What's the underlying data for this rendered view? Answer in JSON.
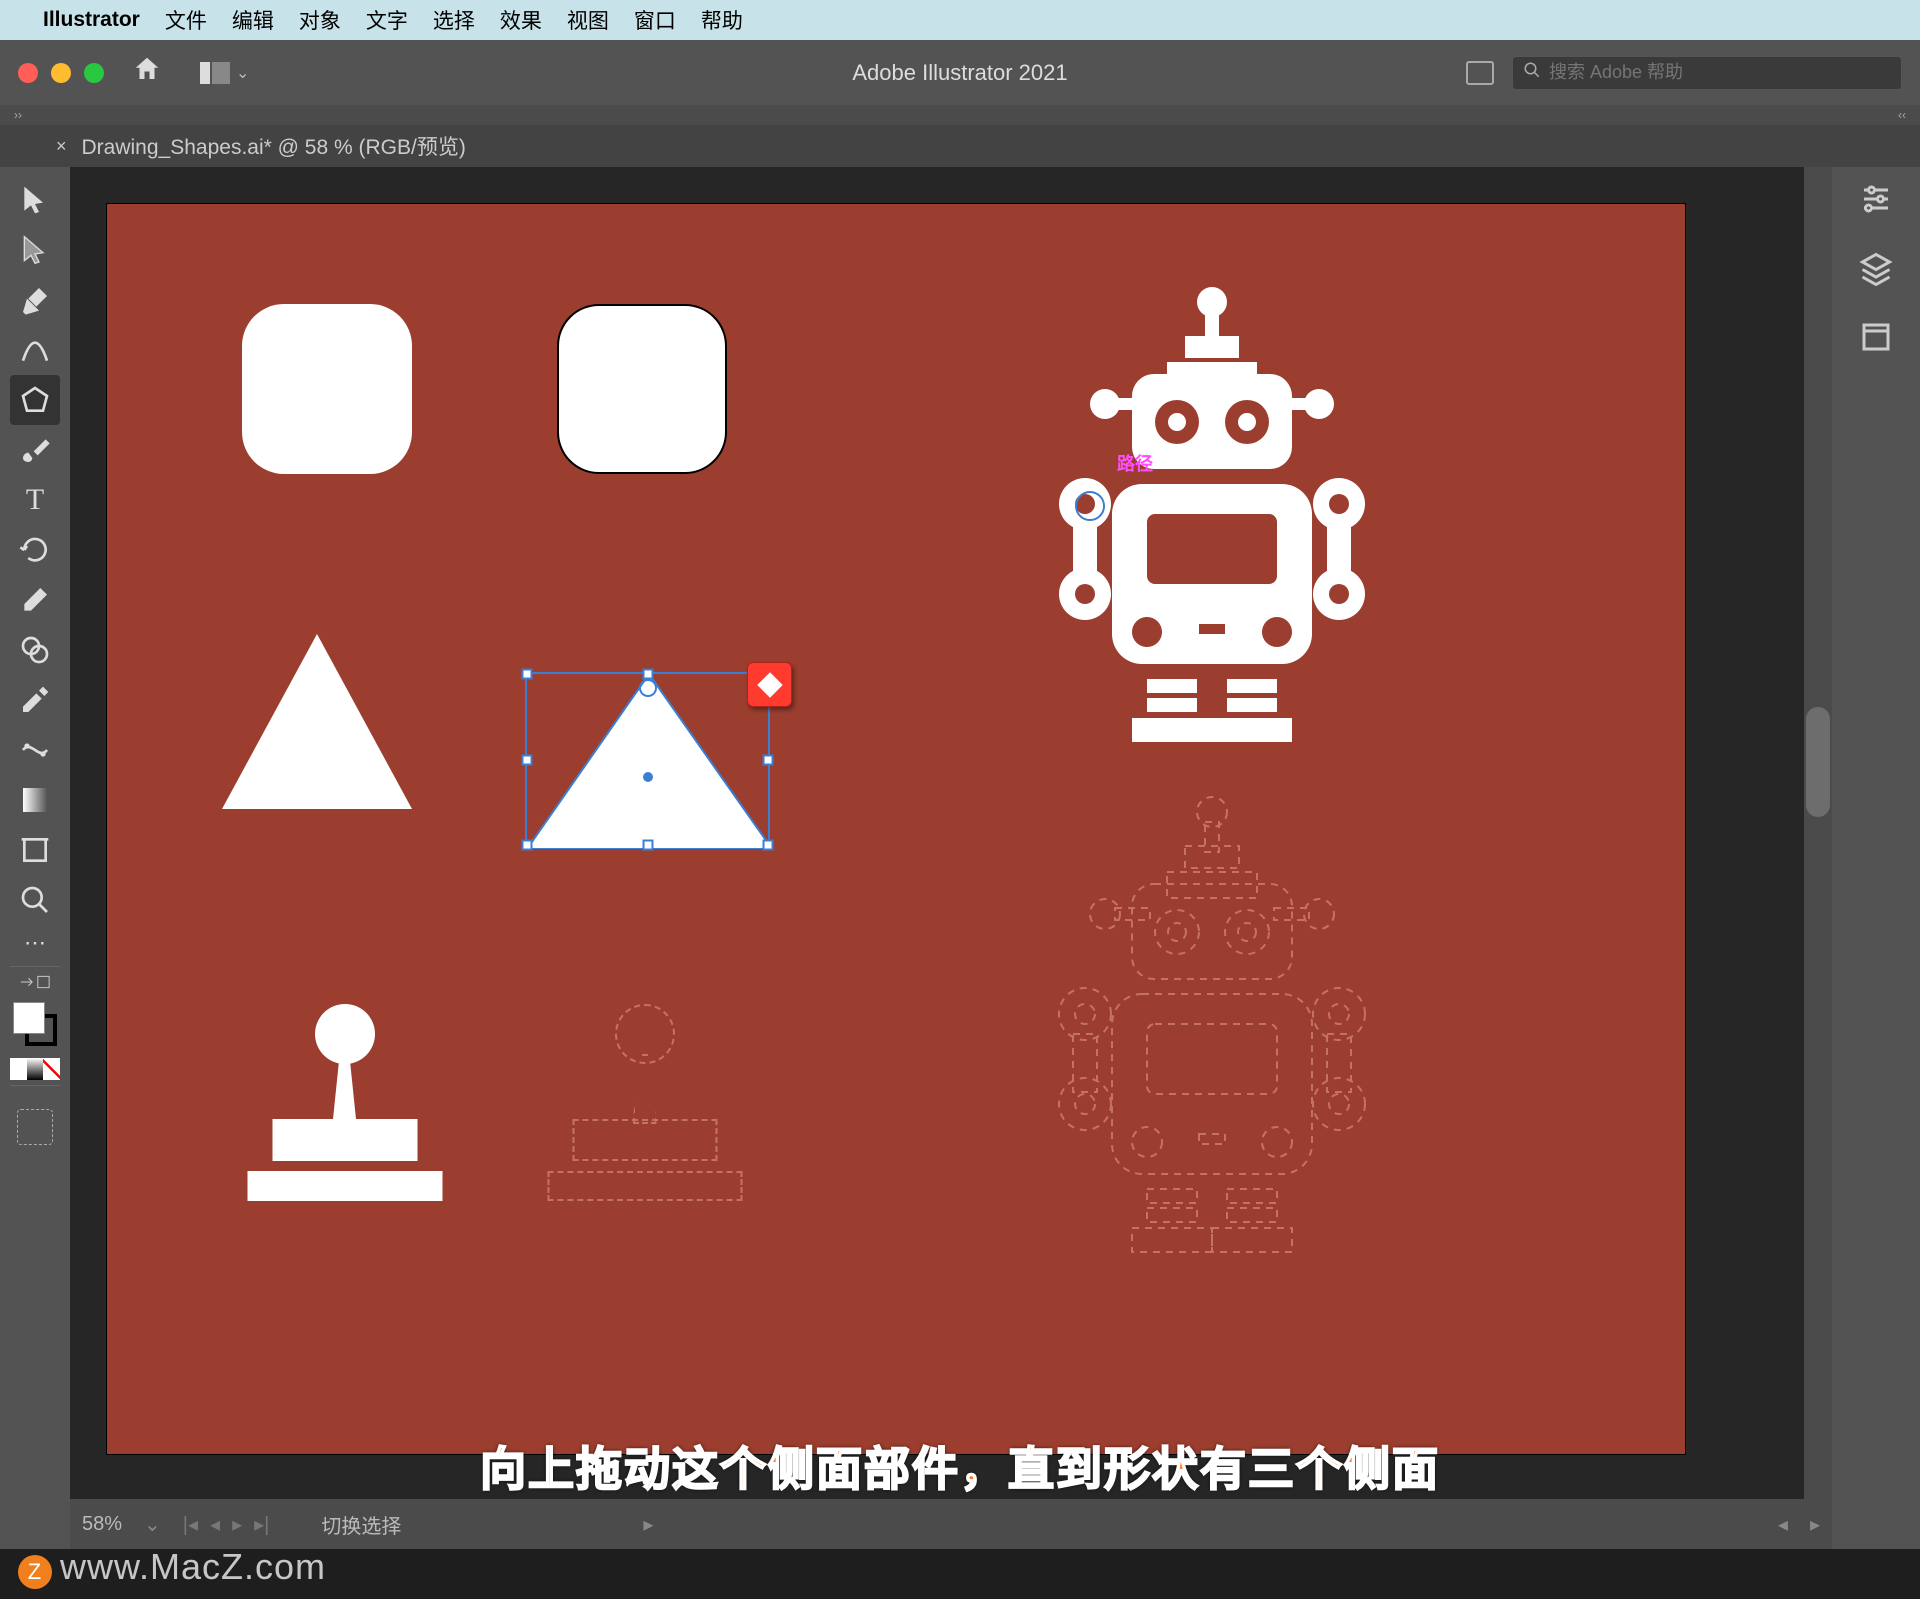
{
  "mac_menu": {
    "app": "Illustrator",
    "items": [
      "文件",
      "编辑",
      "对象",
      "文字",
      "选择",
      "效果",
      "视图",
      "窗口",
      "帮助"
    ]
  },
  "window": {
    "title": "Adobe Illustrator 2021",
    "search_placeholder": "搜索 Adobe 帮助"
  },
  "document": {
    "tab_label": "Drawing_Shapes.ai* @ 58 % (RGB/预览)"
  },
  "canvas": {
    "path_label": "路径"
  },
  "status": {
    "zoom": "58%",
    "selection_label": "切换选择"
  },
  "caption": "向上拖动这个侧面部件，直到形状有三个侧面",
  "watermark": "www.MacZ.com",
  "tools": [
    {
      "name": "selection-tool",
      "glyph": "arrow"
    },
    {
      "name": "direct-selection-tool",
      "glyph": "darrow"
    },
    {
      "name": "pen-tool",
      "glyph": "pen"
    },
    {
      "name": "curvature-tool",
      "glyph": "curve"
    },
    {
      "name": "polygon-tool",
      "glyph": "hex",
      "selected": true
    },
    {
      "name": "paintbrush-tool",
      "glyph": "brush"
    },
    {
      "name": "type-tool",
      "glyph": "T"
    },
    {
      "name": "rotate-tool",
      "glyph": "rotate"
    },
    {
      "name": "eraser-tool",
      "glyph": "eraser"
    },
    {
      "name": "shape-builder-tool",
      "glyph": "shapeb"
    },
    {
      "name": "eyedropper-tool",
      "glyph": "eyedrop"
    },
    {
      "name": "width-tool",
      "glyph": "width"
    },
    {
      "name": "gradient-tool",
      "glyph": "grad"
    },
    {
      "name": "artboard-tool",
      "glyph": "artb"
    },
    {
      "name": "zoom-tool",
      "glyph": "zoom"
    }
  ],
  "panels": [
    {
      "name": "properties-panel"
    },
    {
      "name": "layers-panel"
    },
    {
      "name": "libraries-panel"
    }
  ],
  "colors": {
    "artboard": "#9b3e2f",
    "shape_fill": "#ffffff",
    "selection": "#3b7fd4",
    "widget": "#ff3b30"
  }
}
